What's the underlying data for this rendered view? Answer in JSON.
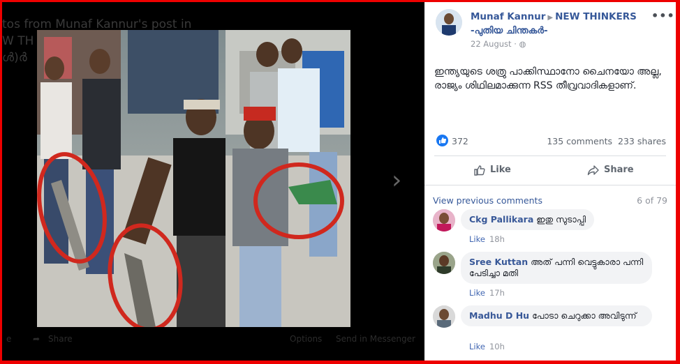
{
  "viewer": {
    "ghost_title_lines": [
      "tos from Munaf Kannur's post in",
      "W TH",
      "ൾ)ർ"
    ],
    "ghost_like": "e",
    "ghost_share": "Share",
    "ghost_options": "Options",
    "ghost_send": "Send in Messenger"
  },
  "post": {
    "author": "Munaf Kannur",
    "group": "NEW THINKERS -പുതിയ ചിന്തകർ-",
    "date": "22 August",
    "text": "ഇന്ത്യയുടെ ശത്രു പാക്കിസ്ഥാനോ ചൈനയോ അല്ല, രാജ്യം ശിഥിലമാക്കുന്ന RSS തീവ്രവാദികളാണ്.",
    "reactions": "372",
    "comments_count": "135 comments",
    "shares_count": "233 shares",
    "like_label": "Like",
    "share_label": "Share"
  },
  "comments_section": {
    "view_previous": "View previous comments",
    "position": "6 of 79",
    "items": [
      {
        "author": "Ckg Pallikara",
        "text": "ഇതു സുടാപ്പി",
        "like": "Like",
        "time": "18h"
      },
      {
        "author": "Sree Kuttan",
        "text": "അത് പന്നി വെട്ടുകാരാ പന്നി പേടിച്ചാ മതി",
        "like": "Like",
        "time": "17h"
      },
      {
        "author": "Madhu D Hu",
        "text": "പോടാ ചെറുക്കാ അവിടുന്ന്",
        "like": "Like",
        "time": "10h"
      }
    ]
  },
  "colors": {
    "frame_border": "#e00000",
    "link": "#365899",
    "like_blue": "#1877f2",
    "circle_red": "#d0281e"
  }
}
